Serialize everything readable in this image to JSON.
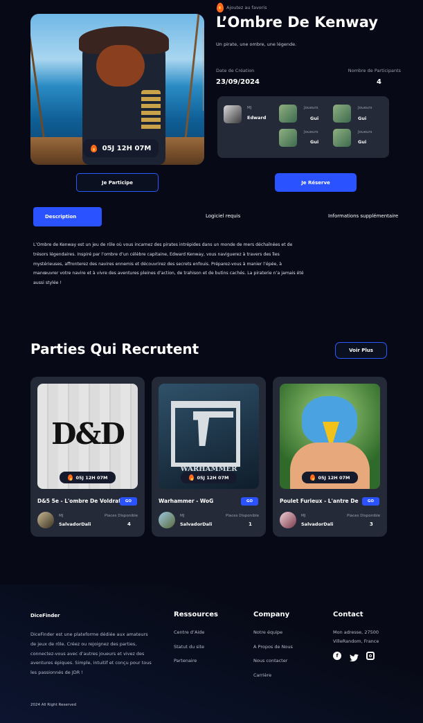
{
  "hero": {
    "favorite_label": "Ajoutez au favoris",
    "title": "L’Ombre De Kenway",
    "tagline": "Un pirate, une ombre, une légende.",
    "timer": "05J 12H 07M",
    "creation_label": "Date de Création",
    "creation_value": "23/09/2024",
    "participants_label": "Nombre de Participants",
    "participants_value": "4",
    "mj_role": "MJ",
    "mj_name": "Edward",
    "players": [
      {
        "role": "Joueurs",
        "name": "Gui"
      },
      {
        "role": "Joueurs",
        "name": "Gui"
      },
      {
        "role": "Joueurs",
        "name": "Gui"
      },
      {
        "role": "Joueurs",
        "name": "Gui"
      }
    ],
    "join_button": "Je Participe",
    "reserve_button": "Je Réserve"
  },
  "tabs": [
    "Description",
    "Logiciel requis",
    "Informations supplémentaire"
  ],
  "description": "L’Ombre de Kenway est un jeu de rôle où vous incarnez des pirates intrépides dans un monde de mers déchaînées et de trésors légendaires. Inspiré par l’ombre d’un célèbre capitaine, Edward Kenway, vous naviguerez à travers des îles mystérieuses, affronterez des navires ennemis et découvrirez des secrets enfouis. Préparez-vous à manier l’épée, à manœuvrer votre navire et à vivre des aventures pleines d’action, de trahison et de butins cachés. La piraterie n’a jamais été aussi stylée !",
  "recruiting": {
    "title": "Parties Qui Recrutent",
    "more_button": "Voir Plus",
    "cards": [
      {
        "name": "D&5 5e - L'ombre De Voldrath",
        "go": "GO",
        "timer": "05J 12H 07M",
        "mj_role": "MJ",
        "mj_name": "SalvadorDali",
        "places_label": "Places Disponible",
        "places": "4",
        "logo_text": "D&D"
      },
      {
        "name": "Warhammer - WoG",
        "go": "GO",
        "timer": "05J 12H 07M",
        "mj_role": "MJ",
        "mj_name": "SalvadorDali",
        "places_label": "Places Disponible",
        "places": "1",
        "logo_text": "WARHAMMER"
      },
      {
        "name": "Poulet Furieux - L'antre Des Lo",
        "go": "GO",
        "timer": "05J 12H 07M",
        "mj_role": "MJ",
        "mj_name": "SalvadorDali",
        "places_label": "Places Disponible",
        "places": "3",
        "logo_text": ""
      }
    ]
  },
  "footer": {
    "brand": "DiceFinder",
    "about": "DiceFinder est une plateforme dédiée aux amateurs de jeux de rôle. Créez ou rejoignez des parties, connectez-vous avec d’autres joueurs et vivez des aventures épiques. Simple, intuitif et conçu pour tous les passionnés de JDR !",
    "resources_title": "Ressources",
    "resources": [
      "Centre d’Aide",
      "Statut du site",
      "Partenaire"
    ],
    "company_title": "Company",
    "company": [
      "Notre équipe",
      "A Propos de Nous",
      "Nous contacter",
      "Carrière"
    ],
    "contact_title": "Contact",
    "address_line1": "Mon adresse, 27500",
    "address_line2": "VilleRandom, France",
    "copyright": "2024 All Right Reserved"
  },
  "colors": {
    "accent": "#2b52ff",
    "background": "#070a16",
    "panel": "#242a38",
    "fire": "#ff6a1a"
  }
}
